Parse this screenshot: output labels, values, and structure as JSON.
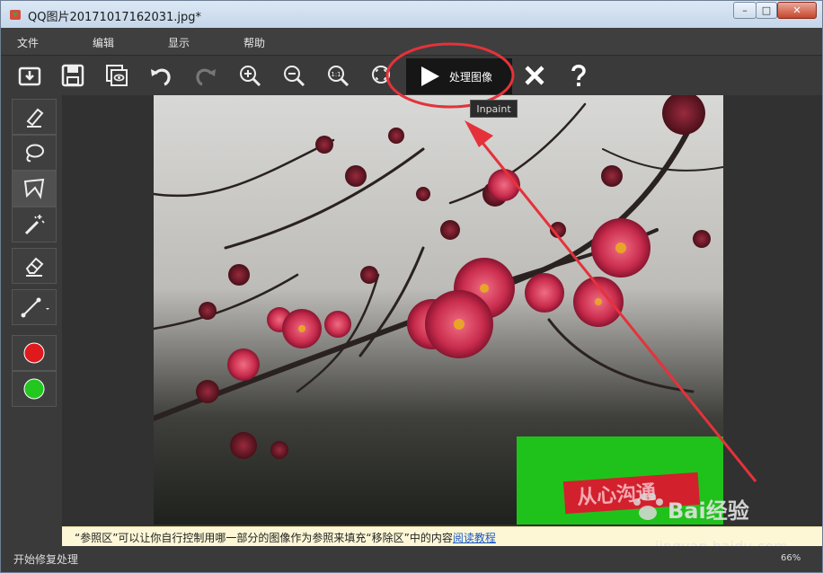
{
  "window": {
    "title": "QQ图片20171017162031.jpg*",
    "controls": {
      "minimize": "–",
      "maximize": "□",
      "close": "✕"
    }
  },
  "menu": {
    "items": [
      "文件",
      "编辑",
      "显示",
      "帮助"
    ]
  },
  "toolbar": {
    "buttons": [
      "open-icon",
      "save-icon",
      "save-copy-icon",
      "undo-icon",
      "redo-icon",
      "zoom-in-icon",
      "zoom-out-icon",
      "actual-size-icon",
      "fit-icon"
    ],
    "actual_size_label": "1:1",
    "process_label": "处理图像",
    "tooltip": "Inpaint"
  },
  "tools": {
    "items": [
      "marker-icon",
      "lasso-icon",
      "polygon-lasso-icon",
      "magic-wand-icon",
      "eraser-icon",
      "line-icon"
    ],
    "colors": {
      "red": "#e0191c",
      "green": "#22c71f"
    }
  },
  "canvas": {
    "accent_green": "#1fc21b",
    "watermark_text": "从心沟通"
  },
  "info": {
    "message": "“参照区”可以让你自行控制用哪一部分的图像作为参照来填充“移除区”中的内容",
    "link": "阅读教程"
  },
  "status": {
    "left": "开始修复处理",
    "zoom": "66%"
  },
  "branding": {
    "text": "Bai经验",
    "url": "jingyan.baidu.com"
  }
}
